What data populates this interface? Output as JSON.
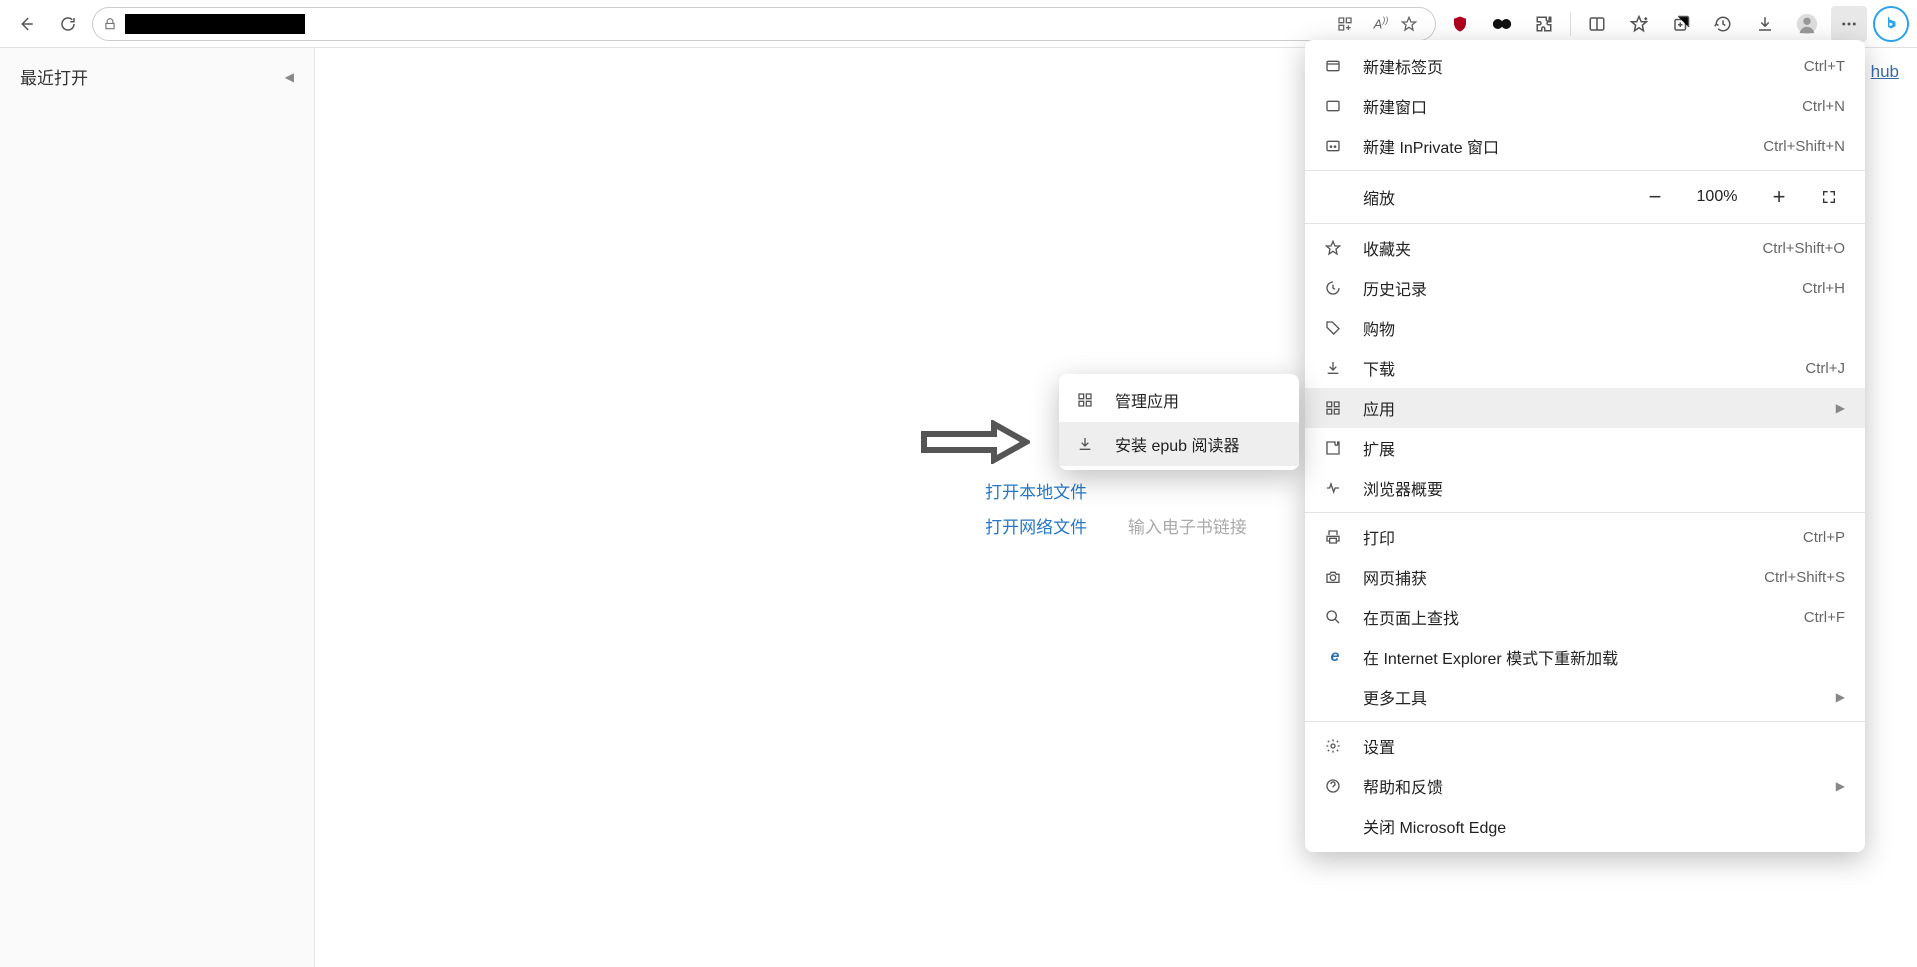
{
  "toolbar": {
    "hub_link": "hub"
  },
  "sidebar": {
    "title": "最近打开"
  },
  "center": {
    "open_local": "打开本地文件",
    "open_remote": "打开网络文件",
    "remote_hint": "输入电子书链接"
  },
  "submenu": {
    "manage_apps": "管理应用",
    "install_epub": "安装 epub 阅读器"
  },
  "zoom": {
    "label": "缩放",
    "value": "100%"
  },
  "menu": {
    "new_tab": {
      "label": "新建标签页",
      "shortcut": "Ctrl+T"
    },
    "new_window": {
      "label": "新建窗口",
      "shortcut": "Ctrl+N"
    },
    "new_inprivate": {
      "label": "新建 InPrivate 窗口",
      "shortcut": "Ctrl+Shift+N"
    },
    "favorites": {
      "label": "收藏夹",
      "shortcut": "Ctrl+Shift+O"
    },
    "history": {
      "label": "历史记录",
      "shortcut": "Ctrl+H"
    },
    "shopping": {
      "label": "购物"
    },
    "downloads": {
      "label": "下载",
      "shortcut": "Ctrl+J"
    },
    "apps": {
      "label": "应用"
    },
    "extensions": {
      "label": "扩展"
    },
    "browser_essentials": {
      "label": "浏览器概要"
    },
    "print": {
      "label": "打印",
      "shortcut": "Ctrl+P"
    },
    "web_capture": {
      "label": "网页捕获",
      "shortcut": "Ctrl+Shift+S"
    },
    "find": {
      "label": "在页面上查找",
      "shortcut": "Ctrl+F"
    },
    "ie_mode": {
      "label": "在 Internet Explorer 模式下重新加载"
    },
    "more_tools": {
      "label": "更多工具"
    },
    "settings": {
      "label": "设置"
    },
    "help": {
      "label": "帮助和反馈"
    },
    "close_edge": {
      "label": "关闭 Microsoft Edge"
    }
  }
}
